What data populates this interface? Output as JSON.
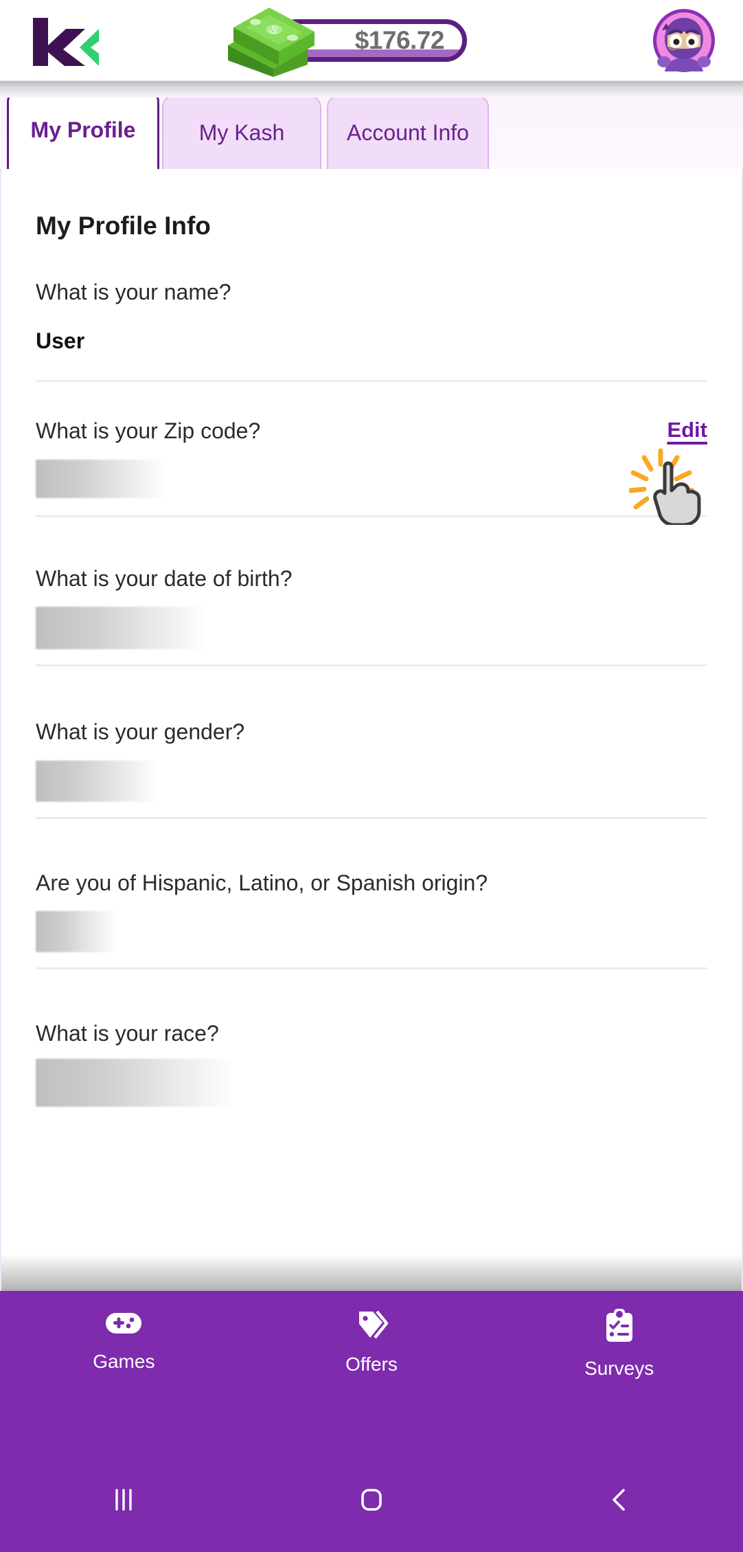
{
  "header": {
    "logo_name": "kashkick-logo",
    "balance": "$176.72",
    "cash_icon": "cash-stack-icon",
    "avatar_icon": "ninja-avatar-icon"
  },
  "tabs": [
    {
      "label": "My Profile",
      "active": true
    },
    {
      "label": "My Kash",
      "active": false
    },
    {
      "label": "Account Info",
      "active": false
    }
  ],
  "main": {
    "section_title": "My Profile Info",
    "fields": [
      {
        "label": "What is your name?",
        "value": "User",
        "redacted": false,
        "edit_label": null
      },
      {
        "label": "What is your Zip code?",
        "value": "",
        "redacted": true,
        "edit_label": "Edit"
      },
      {
        "label": "What is your date of birth?",
        "value": "",
        "redacted": true,
        "edit_label": null
      },
      {
        "label": "What is your gender?",
        "value": "",
        "redacted": true,
        "edit_label": null
      },
      {
        "label": "Are you of Hispanic, Latino, or Spanish origin?",
        "value": "",
        "redacted": true,
        "edit_label": null
      },
      {
        "label": "What is your race?",
        "value": "",
        "redacted": true,
        "edit_label": null
      }
    ]
  },
  "bottom_nav": [
    {
      "label": "Games",
      "icon": "gamepad-icon"
    },
    {
      "label": "Offers",
      "icon": "tag-icon"
    },
    {
      "label": "Surveys",
      "icon": "clipboard-checklist-icon"
    }
  ],
  "android_nav": [
    {
      "icon": "recents-icon"
    },
    {
      "icon": "home-icon"
    },
    {
      "icon": "back-icon"
    }
  ],
  "colors": {
    "brand_purple": "#7e2bae",
    "deep_purple": "#5c1f80",
    "tab_inactive_bg": "#f1ddf8",
    "logo_green": "#2fd072",
    "money_green": "#5cb82b",
    "edit_link": "#7019a5"
  }
}
